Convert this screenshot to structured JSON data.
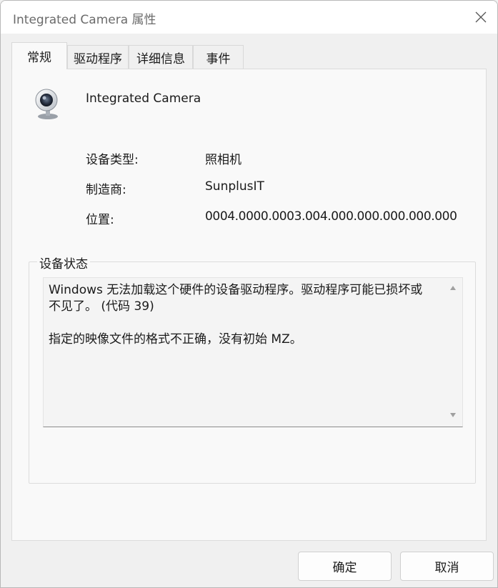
{
  "window": {
    "title": "Integrated Camera 属性"
  },
  "tabs": [
    {
      "label": "常规",
      "active": true
    },
    {
      "label": "驱动程序",
      "active": false
    },
    {
      "label": "详细信息",
      "active": false
    },
    {
      "label": "事件",
      "active": false
    }
  ],
  "device": {
    "name": "Integrated Camera",
    "icon": "webcam-icon"
  },
  "properties": [
    {
      "label": "设备类型:",
      "value": "照相机"
    },
    {
      "label": "制造商:",
      "value": "SunplusIT"
    },
    {
      "label": "位置:",
      "value": "0004.0000.0003.004.000.000.000.000.000"
    }
  ],
  "status": {
    "group_label": "设备状态",
    "line1": "Windows 无法加载这个硬件的设备驱动程序。驱动程序可能已损坏或不见了。 (代码 39)",
    "line2": "指定的映像文件的格式不正确，没有初始 MZ。"
  },
  "buttons": {
    "ok": "确定",
    "cancel": "取消"
  },
  "colors": {
    "title_text": "#6b6b6b",
    "panel_bg": "#f9f9f9",
    "window_bg": "#f0f0f0"
  }
}
